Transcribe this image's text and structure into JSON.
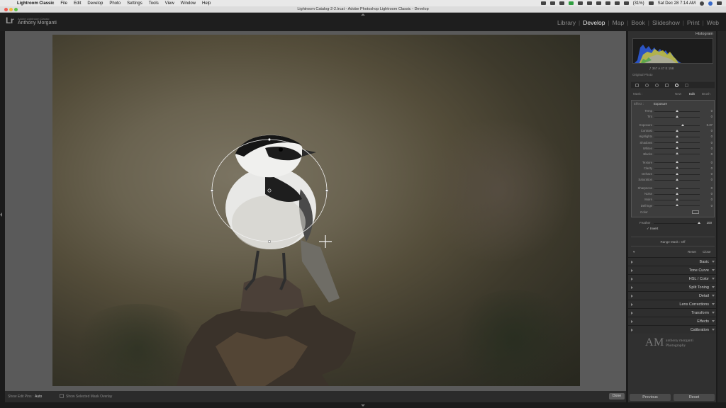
{
  "menubar": {
    "app": "Lightroom Classic",
    "items": [
      "File",
      "Edit",
      "Develop",
      "Photo",
      "Settings",
      "Tools",
      "View",
      "Window",
      "Help"
    ],
    "battery": "(31%)",
    "datetime": "Sat Dec 28  7:14 AM"
  },
  "window": {
    "title": "Lightroom Catalog-2-2.lrcat - Adobe Photoshop Lightroom Classic - Develop"
  },
  "identity": {
    "logo": "Lr",
    "subtitle": "Adobe Lightroom Classic",
    "name": "Anthony Morganti"
  },
  "modules": [
    {
      "label": "Library",
      "active": false
    },
    {
      "label": "Develop",
      "active": true
    },
    {
      "label": "Map",
      "active": false
    },
    {
      "label": "Book",
      "active": false
    },
    {
      "label": "Slideshow",
      "active": false
    },
    {
      "label": "Print",
      "active": false
    },
    {
      "label": "Web",
      "active": false
    }
  ],
  "toolbar": {
    "show_edit_pins_label": "Show Edit Pins :",
    "show_edit_pins_value": "Auto",
    "overlay_label": "Show Selected Mask Overlay",
    "done_label": "Done"
  },
  "panel": {
    "histogram_title": "Histogram",
    "histogram_readout": "ƒ   367   A   47   E   158",
    "original_photo": "Original Photo",
    "mask_label": "Mask :",
    "mask_new": "New",
    "mask_edit": "Edit",
    "mask_brush": "Brush",
    "effect_label": "Effect :",
    "effect_value": "Exposure",
    "sliders": [
      {
        "name": "Temp",
        "value": "0",
        "pos": 0.5
      },
      {
        "name": "Tint",
        "value": "0",
        "pos": 0.5
      },
      {
        "name": "Exposure",
        "value": "0.37",
        "pos": 0.62
      },
      {
        "name": "Contrast",
        "value": "0",
        "pos": 0.5
      },
      {
        "name": "Highlights",
        "value": "0",
        "pos": 0.5
      },
      {
        "name": "Shadows",
        "value": "0",
        "pos": 0.5
      },
      {
        "name": "Whites",
        "value": "0",
        "pos": 0.5
      },
      {
        "name": "Blacks",
        "value": "0",
        "pos": 0.5
      },
      {
        "name": "Texture",
        "value": "0",
        "pos": 0.5
      },
      {
        "name": "Clarity",
        "value": "0",
        "pos": 0.5
      },
      {
        "name": "Dehaze",
        "value": "0",
        "pos": 0.5
      },
      {
        "name": "Saturation",
        "value": "0",
        "pos": 0.5
      },
      {
        "name": "Sharpness",
        "value": "0",
        "pos": 0.5
      },
      {
        "name": "Noise",
        "value": "0",
        "pos": 0.5
      },
      {
        "name": "Moiré",
        "value": "0",
        "pos": 0.5
      },
      {
        "name": "Defringe",
        "value": "0",
        "pos": 0.5
      }
    ],
    "color_label": "Color",
    "feather_label": "Feather",
    "feather_value": "100",
    "invert_label": "Invert",
    "range_mask": "Range Mask : Off",
    "reset_label": "Reset",
    "close_label": "Close",
    "sections": [
      "Basic",
      "Tone Curve",
      "HSL / Color",
      "Split Toning",
      "Detail",
      "Lens Corrections",
      "Transform",
      "Effects",
      "Calibration"
    ],
    "watermark_initials": "AM",
    "watermark_line1": "anthony morganti",
    "watermark_line2": "Photography"
  },
  "bottom": {
    "previous": "Previous",
    "reset": "Reset"
  }
}
